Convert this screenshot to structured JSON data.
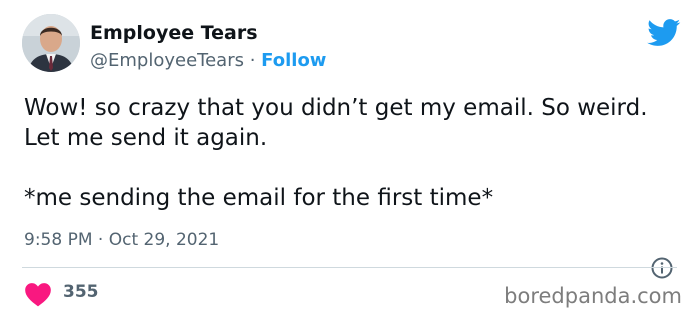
{
  "author": {
    "name": "Employee Tears",
    "handle": "@EmployeeTears",
    "separator": "·",
    "follow_label": "Follow"
  },
  "tweet": {
    "text": "Wow! so crazy that you didn’t get my email. So weird. Let me send it again.\n\n*me sending the email for the first time*",
    "time": "9:58 PM",
    "date_separator": "·",
    "date": "Oct 29, 2021",
    "likes": "355"
  },
  "icons": {
    "platform": "twitter-bird-icon",
    "info": "info-icon",
    "like": "heart-icon"
  },
  "colors": {
    "accent": "#1d9bf0",
    "like": "#f91880",
    "text": "#0f1419",
    "muted": "#536471"
  },
  "watermark": "boredpanda.com"
}
